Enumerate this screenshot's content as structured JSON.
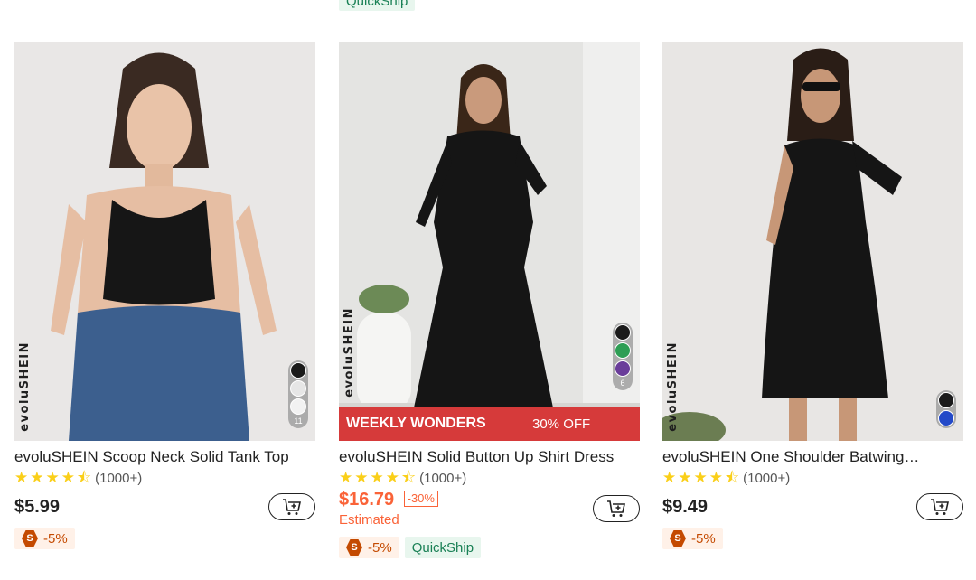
{
  "top_partial_tag": "QuickShip",
  "colors": {
    "accent_sale": "#fa6338",
    "promo_bar": "#d63a3a",
    "quickship_green": "#198055",
    "coupon_brown": "#c44a01",
    "star_yellow": "#facf19"
  },
  "products": [
    {
      "title": "evoluSHEIN Scoop Neck Solid Tank Top",
      "brand_mark": "evoluSHEIN",
      "rating_stars": 4.5,
      "review_count": "(1000+)",
      "price": "$5.99",
      "coupon_label": "-5%",
      "coupon_icon_glyph": "S",
      "swatches": [
        "#1a1a1a",
        "#e6e6e6",
        "#f2f2f2"
      ],
      "swatch_count": "11"
    },
    {
      "title": "evoluSHEIN Solid Button Up Shirt Dress",
      "brand_mark": "evoluSHEIN",
      "rating_stars": 4.5,
      "review_count": "(1000+)",
      "price": "$16.79",
      "discount": "-30%",
      "price_note": "Estimated",
      "coupon_label": "-5%",
      "coupon_icon_glyph": "S",
      "quickship_label": "QuickShip",
      "promo_title": "WEEKLY WONDERS",
      "promo_off": "30% OFF",
      "swatches": [
        "#1a1a1a",
        "#2e9e55",
        "#6a3d9a"
      ],
      "swatch_count": "6"
    },
    {
      "title": "evoluSHEIN One Shoulder Batwing…",
      "brand_mark": "evoluSHEIN",
      "rating_stars": 4.5,
      "review_count": "(1000+)",
      "price": "$9.49",
      "coupon_label": "-5%",
      "coupon_icon_glyph": "S",
      "swatches": [
        "#1a1a1a",
        "#2349c8"
      ]
    }
  ]
}
